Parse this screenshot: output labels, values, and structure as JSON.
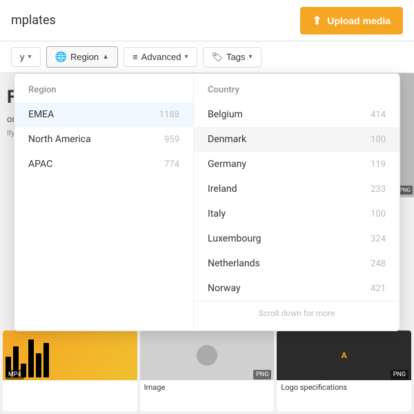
{
  "header": {
    "title": "mplates",
    "upload_label": "Upload media"
  },
  "toolbar": {
    "filter_label": "y",
    "region_label": "Region",
    "advanced_label": "Advanced",
    "tags_label": "Tags"
  },
  "dropdown": {
    "region_header": "Region",
    "country_header": "Country",
    "regions": [
      {
        "name": "EMEA",
        "count": "1188"
      },
      {
        "name": "North America",
        "count": "959"
      },
      {
        "name": "APAC",
        "count": "774"
      }
    ],
    "countries": [
      {
        "name": "Belgium",
        "count": "414"
      },
      {
        "name": "Denmark",
        "count": "100",
        "hovered": true
      },
      {
        "name": "Germany",
        "count": "119"
      },
      {
        "name": "Ireland",
        "count": "233"
      },
      {
        "name": "Italy",
        "count": "100"
      },
      {
        "name": "Luxembourg",
        "count": "324"
      },
      {
        "name": "Netherlands",
        "count": "248"
      },
      {
        "name": "Norway",
        "count": "421"
      }
    ],
    "scroll_hint": "Scroll down for more"
  },
  "bottom_cards": [
    {
      "badge": "MP4",
      "label": ""
    },
    {
      "badge": "PNG",
      "label": "Image"
    },
    {
      "badge": "PNG",
      "label": "Logo specifications"
    }
  ]
}
